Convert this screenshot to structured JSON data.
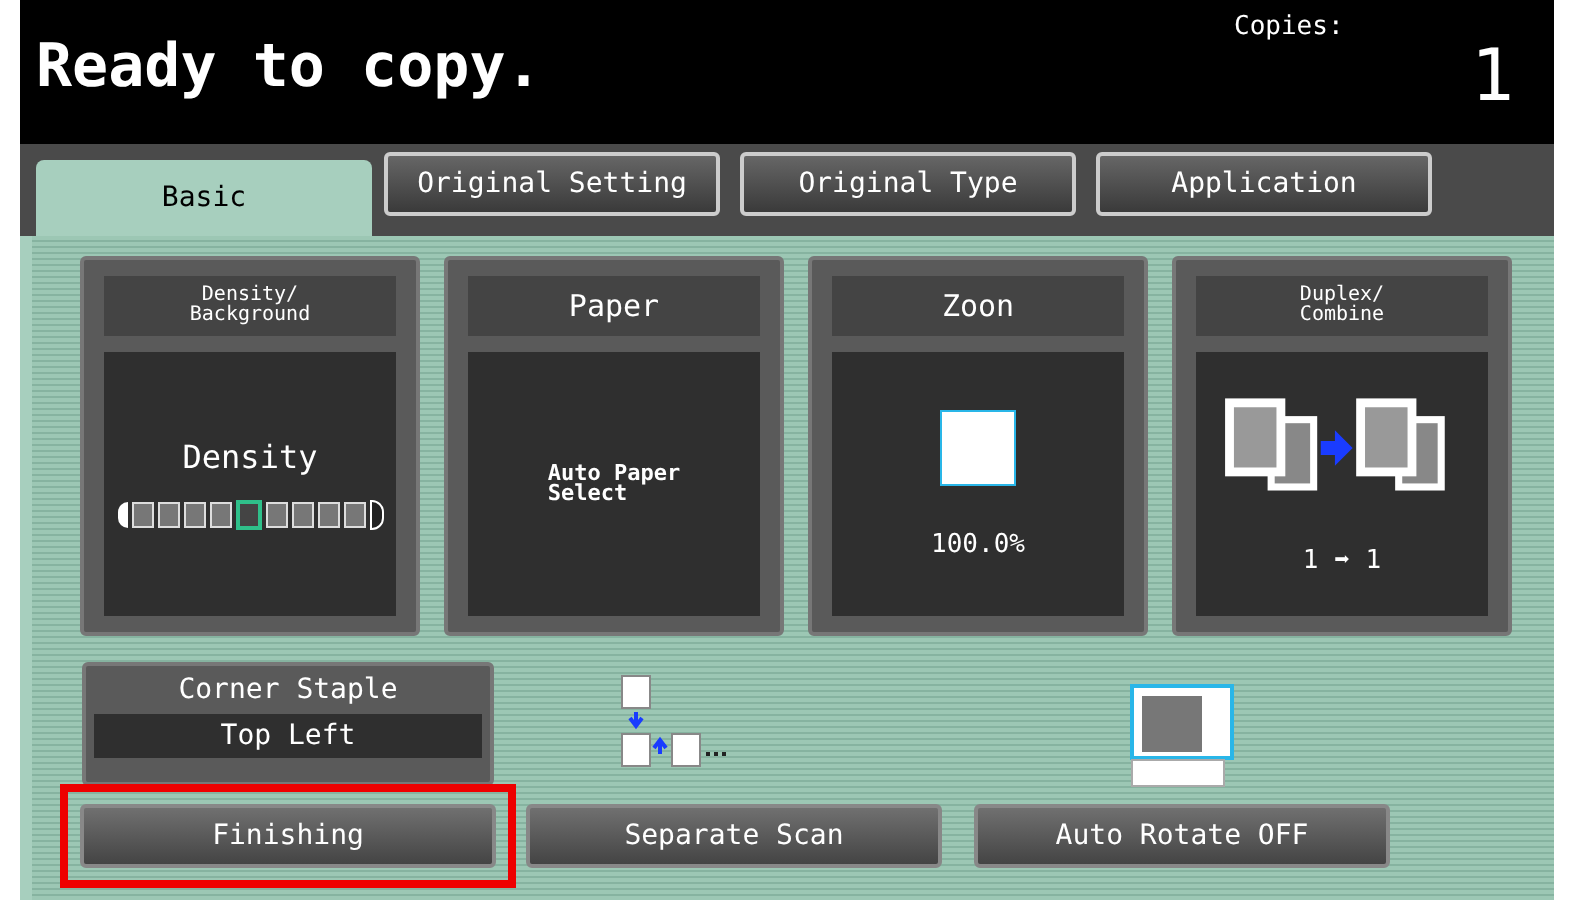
{
  "header": {
    "message": "Ready to copy.",
    "copies_label": "Copies:",
    "copies": "1"
  },
  "tabs": [
    {
      "label": "Basic",
      "selected": true
    },
    {
      "label": "Original Setting",
      "selected": false
    },
    {
      "label": "Original Type",
      "selected": false
    },
    {
      "label": "Application",
      "selected": false
    }
  ],
  "function_keys": [
    {
      "kind": "density",
      "title": "Density/\nBackground",
      "label": "Density",
      "level": 0.5
    },
    {
      "kind": "paper",
      "title": "Paper",
      "label": "Auto Paper\nSelect"
    },
    {
      "kind": "zoom",
      "title": "Zoon",
      "label": "100.0%"
    },
    {
      "kind": "duplex",
      "title": "Duplex/\nCombine",
      "label": "1 ➡ 1"
    }
  ],
  "staple": {
    "title": "Corner Staple",
    "value": "Top Left"
  },
  "buttons": [
    {
      "label": "Finishing",
      "highlighted": true
    },
    {
      "label": "Separate Scan",
      "highlighted": false
    },
    {
      "label": "Auto Rotate OFF",
      "highlighted": false
    }
  ]
}
